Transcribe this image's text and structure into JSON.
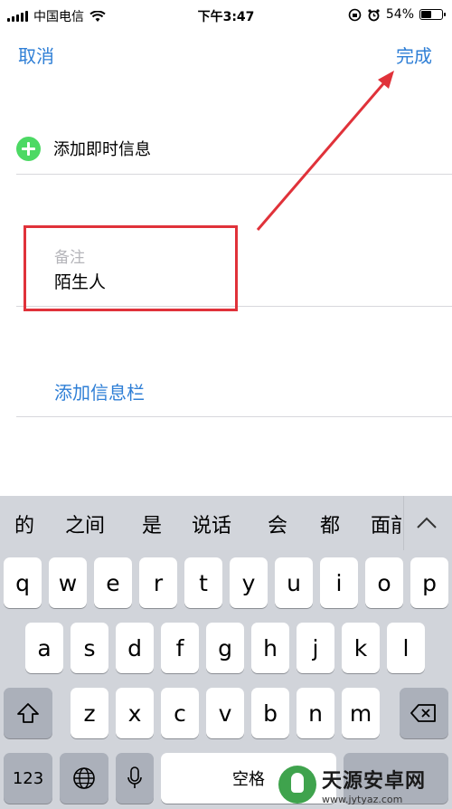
{
  "status_bar": {
    "carrier": "中国电信",
    "time": "下午3:47",
    "battery_percent": "54%",
    "battery_level": 0.54
  },
  "nav": {
    "cancel_label": "取消",
    "done_label": "完成"
  },
  "contact": {
    "add_im_label": "添加即时信息",
    "note_label": "备注",
    "note_value": "陌生人",
    "add_field_label": "添加信息栏"
  },
  "keyboard": {
    "suggestions": [
      "的",
      "之间",
      "是",
      "说话",
      "会",
      "都",
      "面前"
    ],
    "row1": [
      "q",
      "w",
      "e",
      "r",
      "t",
      "y",
      "u",
      "i",
      "o",
      "p"
    ],
    "row2": [
      "a",
      "s",
      "d",
      "f",
      "g",
      "h",
      "j",
      "k",
      "l"
    ],
    "row3": [
      "z",
      "x",
      "c",
      "v",
      "b",
      "n",
      "m"
    ],
    "numbers_label": "123",
    "space_label": "空格"
  },
  "watermark": {
    "title": "天源安卓网",
    "url": "www.jytyaz.com"
  },
  "colors": {
    "accent": "#2f7fd6",
    "annotation_red": "#e0323a",
    "add_green": "#4cd964"
  }
}
